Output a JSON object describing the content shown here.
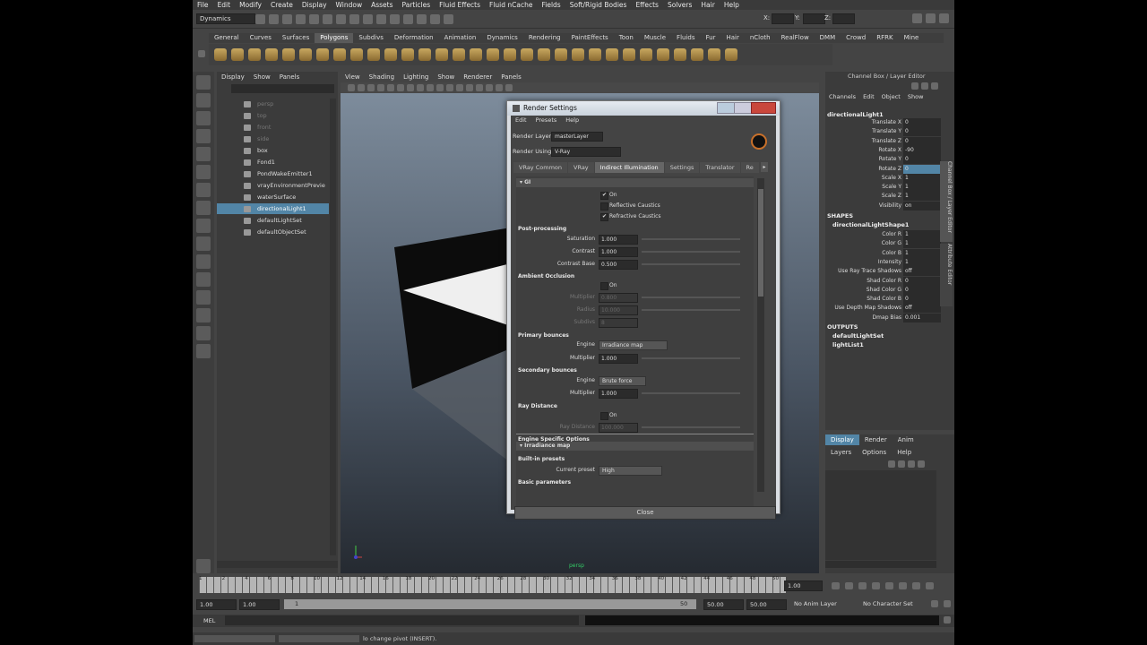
{
  "menubar": [
    "File",
    "Edit",
    "Modify",
    "Create",
    "Display",
    "Window",
    "Assets",
    "Particles",
    "Fluid Effects",
    "Fluid nCache",
    "Fields",
    "Soft/Rigid Bodies",
    "Effects",
    "Solvers",
    "Hair",
    "Help"
  ],
  "status": {
    "menuset": "Dynamics",
    "x_label": "X:",
    "y_label": "Y:",
    "z_label": "Z:"
  },
  "shelf_tabs": [
    "General",
    "Curves",
    "Surfaces",
    "Polygons",
    "Subdivs",
    "Deformation",
    "Animation",
    "Dynamics",
    "Rendering",
    "PaintEffects",
    "Toon",
    "Muscle",
    "Fluids",
    "Fur",
    "Hair",
    "nCloth",
    "RealFlow",
    "DMM",
    "Crowd",
    "RFRK",
    "Mine"
  ],
  "shelf_active": "Polygons",
  "outliner": {
    "menu": [
      "Display",
      "Show",
      "Panels"
    ],
    "items": [
      {
        "label": "persp",
        "state": "dim"
      },
      {
        "label": "top",
        "state": "dim"
      },
      {
        "label": "front",
        "state": "dim"
      },
      {
        "label": "side",
        "state": "dim"
      },
      {
        "label": "box",
        "state": "normal"
      },
      {
        "label": "Fond1",
        "state": "normal"
      },
      {
        "label": "PondWakeEmitter1",
        "state": "normal"
      },
      {
        "label": "vrayEnvironmentPrevie",
        "state": "normal"
      },
      {
        "label": "waterSurface",
        "state": "normal"
      },
      {
        "label": "directionalLight1",
        "state": "selected"
      },
      {
        "label": "defaultLightSet",
        "state": "normal"
      },
      {
        "label": "defaultObjectSet",
        "state": "normal"
      }
    ]
  },
  "viewport": {
    "menu": [
      "View",
      "Shading",
      "Lighting",
      "Show",
      "Renderer",
      "Panels"
    ],
    "cam_label": "persp"
  },
  "render_settings": {
    "title": "Render Settings",
    "menu": [
      "Edit",
      "Presets",
      "Help"
    ],
    "render_layer_label": "Render Layer",
    "render_layer_value": "masterLayer",
    "render_using_label": "Render Using",
    "render_using_value": "V-Ray",
    "tabs": [
      "VRay Common",
      "VRay",
      "Indirect Illumination",
      "Settings",
      "Translator",
      "Re"
    ],
    "active_tab": "Indirect Illumination",
    "gi_header": "GI",
    "gi_on": "On",
    "reflective_caustics": "Reflective Caustics",
    "refractive_caustics": "Refractive Caustics",
    "post_processing": "Post-processing",
    "saturation_label": "Saturation",
    "saturation_value": "1.000",
    "contrast_label": "Contrast",
    "contrast_value": "1.000",
    "contrast_base_label": "Contrast Base",
    "contrast_base_value": "0.500",
    "ao_header": "Ambient Occlusion",
    "ao_on": "On",
    "ao_multiplier_label": "Multiplier",
    "ao_multiplier_value": "0.800",
    "ao_radius_label": "Radius",
    "ao_radius_value": "10.000",
    "ao_subdivs_label": "Subdivs",
    "ao_subdivs_value": "8",
    "primary_header": "Primary bounces",
    "primary_engine_label": "Engine",
    "primary_engine_value": "Irradiance map",
    "primary_mult_label": "Multiplier",
    "primary_mult_value": "1.000",
    "secondary_header": "Secondary bounces",
    "secondary_engine_label": "Engine",
    "secondary_engine_value": "Brute force",
    "secondary_mult_label": "Multiplier",
    "secondary_mult_value": "1.000",
    "ray_distance_header": "Ray Distance",
    "ray_on": "On",
    "ray_distance_label": "Ray Distance",
    "ray_distance_value": "100.000",
    "engine_specific": "Engine Specific Options",
    "irradiance_map": "Irradiance map",
    "builtin_presets": "Built-in presets",
    "current_preset_label": "Current preset",
    "current_preset_value": "High",
    "basic_params": "Basic parameters",
    "close": "Close"
  },
  "channel_box": {
    "title": "Channel Box / Layer Editor",
    "menu": [
      "Channels",
      "Edit",
      "Object",
      "Show"
    ],
    "object": "directionalLight1",
    "attrs": [
      {
        "n": "Translate X",
        "v": "0"
      },
      {
        "n": "Translate Y",
        "v": "0"
      },
      {
        "n": "Translate Z",
        "v": "0"
      },
      {
        "n": "Rotate X",
        "v": "-90"
      },
      {
        "n": "Rotate Y",
        "v": "0"
      },
      {
        "n": "Rotate Z",
        "v": "0"
      },
      {
        "n": "Scale X",
        "v": "1"
      },
      {
        "n": "Scale Y",
        "v": "1"
      },
      {
        "n": "Scale Z",
        "v": "1"
      },
      {
        "n": "Visibility",
        "v": "on"
      }
    ],
    "shapes_label": "SHAPES",
    "shape": "directionalLightShape1",
    "shape_attrs": [
      {
        "n": "Color R",
        "v": "1"
      },
      {
        "n": "Color G",
        "v": "1"
      },
      {
        "n": "Color B",
        "v": "1"
      },
      {
        "n": "Intensity",
        "v": "1"
      },
      {
        "n": "Use Ray Trace Shadows",
        "v": "off"
      },
      {
        "n": "Shad Color R",
        "v": "0"
      },
      {
        "n": "Shad Color G",
        "v": "0"
      },
      {
        "n": "Shad Color B",
        "v": "0"
      },
      {
        "n": "Use Depth Map Shadows",
        "v": "off"
      },
      {
        "n": "Dmap Bias",
        "v": "0.001"
      }
    ],
    "outputs_label": "OUTPUTS",
    "outputs": [
      "defaultLightSet",
      "lightList1"
    ],
    "side_tabs": [
      "Channel Box / Layer Editor",
      "Attribute Editor"
    ]
  },
  "layer_editor": {
    "tabs": [
      "Display",
      "Render",
      "Anim"
    ],
    "active": "Display",
    "menu": [
      "Layers",
      "Options",
      "Help"
    ]
  },
  "timeline": {
    "ticks": [
      "1",
      "2",
      "4",
      "6",
      "8",
      "10",
      "12",
      "14",
      "16",
      "18",
      "20",
      "22",
      "24",
      "26",
      "28",
      "30",
      "32",
      "34",
      "36",
      "38",
      "40",
      "42",
      "44",
      "46",
      "48",
      "50"
    ],
    "current": "1.00"
  },
  "range": {
    "start": "1.00",
    "inner_start": "1.00",
    "slider_start": "1",
    "slider_end": "50",
    "inner_end": "50.00",
    "end": "50.00",
    "anim_layer": "No Anim Layer",
    "char_set": "No Character Set"
  },
  "command": {
    "label": "MEL"
  },
  "help_line": "lo change pivot (INSERT)."
}
